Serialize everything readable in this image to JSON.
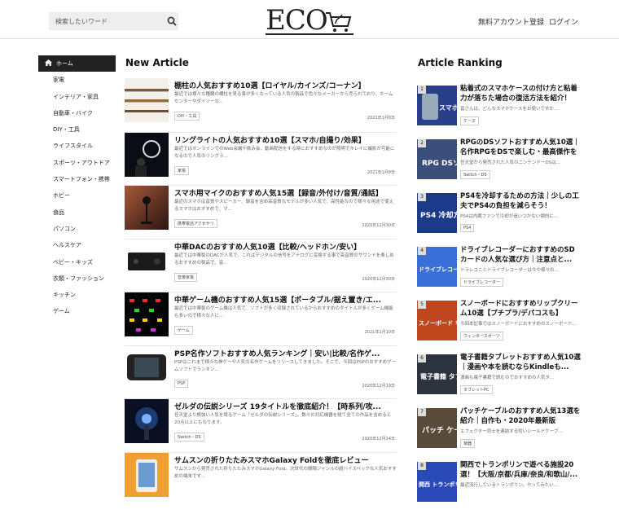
{
  "header": {
    "search_placeholder": "検索したいワード",
    "logo": "ECO",
    "register": "無料アカウント登録",
    "login": "ログイン"
  },
  "sidebar": {
    "items": [
      {
        "label": "ホーム",
        "active": true
      },
      {
        "label": "家電"
      },
      {
        "label": "インテリア・家具"
      },
      {
        "label": "自動車・バイク"
      },
      {
        "label": "DIY・工具"
      },
      {
        "label": "ライフスタイル"
      },
      {
        "label": "スポーツ・アウトドア"
      },
      {
        "label": "スマートフォン・携帯"
      },
      {
        "label": "ホビー"
      },
      {
        "label": "食品"
      },
      {
        "label": "パソコン"
      },
      {
        "label": "ヘルスケア"
      },
      {
        "label": "ベビー・キッズ"
      },
      {
        "label": "衣類・ファッション"
      },
      {
        "label": "キッチン"
      },
      {
        "label": "ゲーム"
      }
    ]
  },
  "new_article": {
    "title": "New Article",
    "items": [
      {
        "title": "棚柱の人気おすすめ10選【ロイヤル/カインズ/コーナン】",
        "desc": "最近では様々な種類の棚柱を見る事が多くなっている人気の製品で色々なメーカーから売られており、ホームセンターやダイソーな...",
        "tag": "DIY・工具",
        "date": "2021年1月8日"
      },
      {
        "title": "リングライトの人気おすすめ10選【スマホ/自撮り/効果】",
        "desc": "最近ではオンラインでのWeb会議や飲み会、動画配信をする時におすすめなのが照明でキレイに撮影が可能になるので人気のリングラ...",
        "tag": "家電",
        "date": "2021年1月8日"
      },
      {
        "title": "スマホ用マイクのおすすめ人気15選【録音/外付け/音質/通話】",
        "desc": "最近のスマホは音質やスピーカー、録音を含め高音質なモデルが多い人気で、高性能なので様々な用途で使えるスマホはおすすめで、マ...",
        "tag": "携帯電話アクセサリ",
        "date": "2020年12月30日"
      },
      {
        "title": "中華DACのおすすめ人気10選【比較/ヘッドホン/安い】",
        "desc": "最近では中華製のDACが人気で、これはデジタルの信号をアナログに変換する事で高音質のサウンドを楽しめるおすすめの製品で、音...",
        "tag": "音楽家電",
        "date": "2020年12月30日"
      },
      {
        "title": "中華ゲーム機のおすすめ人気15選【ポータブル/据え置き/エ...",
        "desc": "最近では中華製のゲーム機は人気で、ソフトが多く収録されているからおすすめのタイトルが多くゲーム機能も多いので様々な人に...",
        "tag": "ゲーム",
        "date": "2021年1月10日"
      },
      {
        "title": "PSP名作ソフトおすすめ人気ランキング｜安い|比較/名作ゲ...",
        "desc": "PSPはこれまで様々な神ゲーや人気の名作ゲームをリリースしてきました。そこで、今回はPSPのおすすめゲームソフトでランキン...",
        "tag": "PSP",
        "date": "2020年12月19日"
      },
      {
        "title": "ゼルダの伝説シリーズ 19タイトルを徹底紹介！【時系列/攻...",
        "desc": "任天堂より根強い人気を誇るゲーム「ゼルダの伝説シリーズ」。数々の対応機器を経て全ての作品を含めると20点以上にもなります。",
        "tag": "Switch・DS",
        "date": "2020年12月14日"
      },
      {
        "title": "サムスンの折りたたみスマホGalaxy Foldを徹底レビュー",
        "desc": "サムスンから発売された折りたたみスマホGalaxy Fold。次世代の間隔ジャンルの超ハイスペックな人気おすすめの端末です...",
        "tag": "",
        "date": ""
      }
    ]
  },
  "ranking": {
    "title": "Article Ranking",
    "items": [
      {
        "num": "1",
        "title": "粘着式のスマホケースの付け方と粘着力が落ちた場合の復活方法を紹介！",
        "desc": "皆さんは、どんなスマホケースをお使いですか...",
        "tag": "ケース",
        "thumb": "スマホケース"
      },
      {
        "num": "2",
        "title": "RPGのDSソフトおすすめ人気10選｜名作RPGをDSで楽しむ・最高傑作をプ...",
        "desc": "任天堂から発売された人気のニンテンドーDSは...",
        "tag": "Switch・DS",
        "thumb": "RPG DSソフト"
      },
      {
        "num": "3",
        "title": "PS4を冷却するための方法｜少しの工夫でPS4の負担を減らそう！",
        "desc": "PS4は内蔵ファンで冷却が追いつかない傾向に...",
        "tag": "PS4",
        "thumb": "PS4 冷却方法"
      },
      {
        "num": "4",
        "title": "ドライブレコーダーにおすすめのSDカードの人気な選び方｜注意点と...",
        "desc": "ドラレコことドライブレコーダーは今や様々の...",
        "tag": "ドライブレコーダー",
        "thumb": "ドライブレコーダー SDカード"
      },
      {
        "num": "5",
        "title": "スノーボードにおすすめリップクリーム10選【プチプラ/デパコスも】",
        "desc": "今回本記事ではスノーボードにおすすめのスノーボード...",
        "tag": "ウィンタースポーツ",
        "thumb": "スノーボード リップクリーム"
      },
      {
        "num": "6",
        "title": "電子書籍タブレットおすすめ人気10選｜漫画や本を読むならKindleも...",
        "desc": "漫画も電子書籍で読むのでおすすめの人気タ...",
        "tag": "タブレットPC",
        "thumb": "電子書籍 タブレット"
      },
      {
        "num": "7",
        "title": "パッチケーブルのおすすめ人気13選を紹介｜自作も・2020年最新版",
        "desc": "エフェクター同士を連結する短いシールドケーブ...",
        "tag": "楽器",
        "thumb": "パッチ ケーブル"
      },
      {
        "num": "8",
        "title": "関西でトランポリンで遊べる施設20選！【大阪/京都/兵庫/奈良/和歌山/...",
        "desc": "最近流行しているトランポリン。やってみたい...",
        "tag": "",
        "thumb": "関西 トランポリン施設"
      }
    ]
  }
}
